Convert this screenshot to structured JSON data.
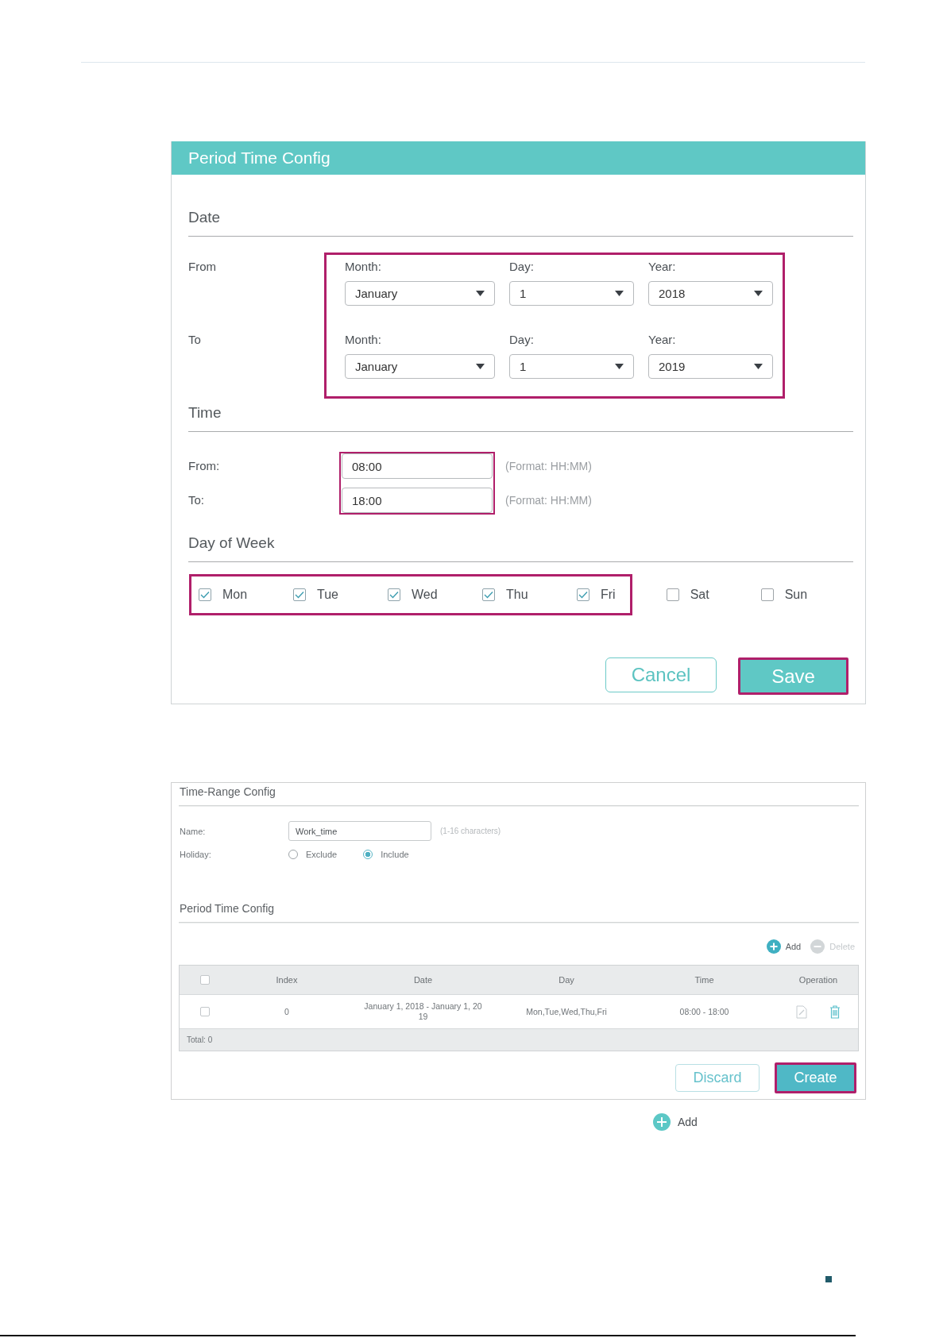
{
  "period_time_config": {
    "title": "Period Time Config",
    "date": {
      "heading": "Date",
      "highlighted": true,
      "rows": [
        {
          "label": "From",
          "fields": [
            {
              "label": "Month:",
              "value": "January"
            },
            {
              "label": "Day:",
              "value": "1"
            },
            {
              "label": "Year:",
              "value": "2018"
            }
          ]
        },
        {
          "label": "To",
          "fields": [
            {
              "label": "Month:",
              "value": "January"
            },
            {
              "label": "Day:",
              "value": "1"
            },
            {
              "label": "Year:",
              "value": "2019"
            }
          ]
        }
      ]
    },
    "time": {
      "heading": "Time",
      "highlighted": true,
      "rows": [
        {
          "label": "From:",
          "value": "08:00",
          "hint": "(Format: HH:MM)"
        },
        {
          "label": "To:",
          "value": "18:00",
          "hint": "(Format: HH:MM)"
        }
      ]
    },
    "day_of_week": {
      "heading": "Day of Week",
      "days": [
        {
          "label": "Mon",
          "checked": true,
          "highlighted": true
        },
        {
          "label": "Tue",
          "checked": true,
          "highlighted": true
        },
        {
          "label": "Wed",
          "checked": true,
          "highlighted": true
        },
        {
          "label": "Thu",
          "checked": true,
          "highlighted": true
        },
        {
          "label": "Fri",
          "checked": true,
          "highlighted": true
        },
        {
          "label": "Sat",
          "checked": false,
          "highlighted": false
        },
        {
          "label": "Sun",
          "checked": false,
          "highlighted": false
        }
      ]
    },
    "buttons": [
      {
        "label": "Cancel",
        "kind": "secondary",
        "highlighted": false
      },
      {
        "label": "Save",
        "kind": "primary",
        "highlighted": true
      }
    ]
  },
  "time_range_config": {
    "title": "Time-Range Config",
    "name": {
      "label": "Name:",
      "value": "Work_time",
      "hint": "(1-16 characters)"
    },
    "holiday": {
      "label": "Holiday:",
      "options": [
        {
          "label": "Exclude",
          "selected": false
        },
        {
          "label": "Include",
          "selected": true
        }
      ]
    },
    "period_section": {
      "heading": "Period Time Config",
      "actions": [
        {
          "kind": "add",
          "label": "Add",
          "disabled": false
        },
        {
          "kind": "delete",
          "label": "Delete",
          "disabled": true
        }
      ]
    },
    "table": {
      "select_all": {
        "checked": false
      },
      "columns": [
        "Index",
        "Date",
        "Day",
        "Time",
        "Operation"
      ],
      "rows": [
        {
          "checked": false,
          "index": "0",
          "date": "January 1, 2018 - January 1, 2019",
          "day": "Mon,Tue,Wed,Thu,Fri",
          "time": "08:00 - 18:00",
          "operations": [
            {
              "kind": "edit"
            },
            {
              "kind": "delete"
            }
          ]
        }
      ],
      "footer": "Total: 0"
    },
    "buttons": [
      {
        "label": "Discard",
        "kind": "secondary",
        "highlighted": false
      },
      {
        "label": "Create",
        "kind": "primary",
        "highlighted": true
      }
    ]
  },
  "legend": {
    "kind": "add",
    "label": "Add"
  }
}
